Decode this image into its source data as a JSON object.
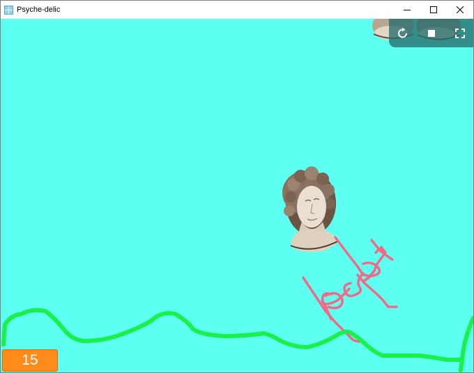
{
  "window": {
    "title": "Psyche-delic",
    "controls": [
      "minimize",
      "maximize",
      "close"
    ]
  },
  "game": {
    "score": "15",
    "overlay_buttons": [
      "restart-icon",
      "stop-icon",
      "fullscreen-icon"
    ],
    "colors": {
      "background": "#5cfff0",
      "ground_line": "#19f04a",
      "trail": "#f06a88",
      "score_bg": "#ff8c1a",
      "overlay_bg": "#286e6e"
    },
    "sprites": [
      "statue-head",
      "statue-head-partial-left",
      "statue-head-partial-right"
    ]
  }
}
